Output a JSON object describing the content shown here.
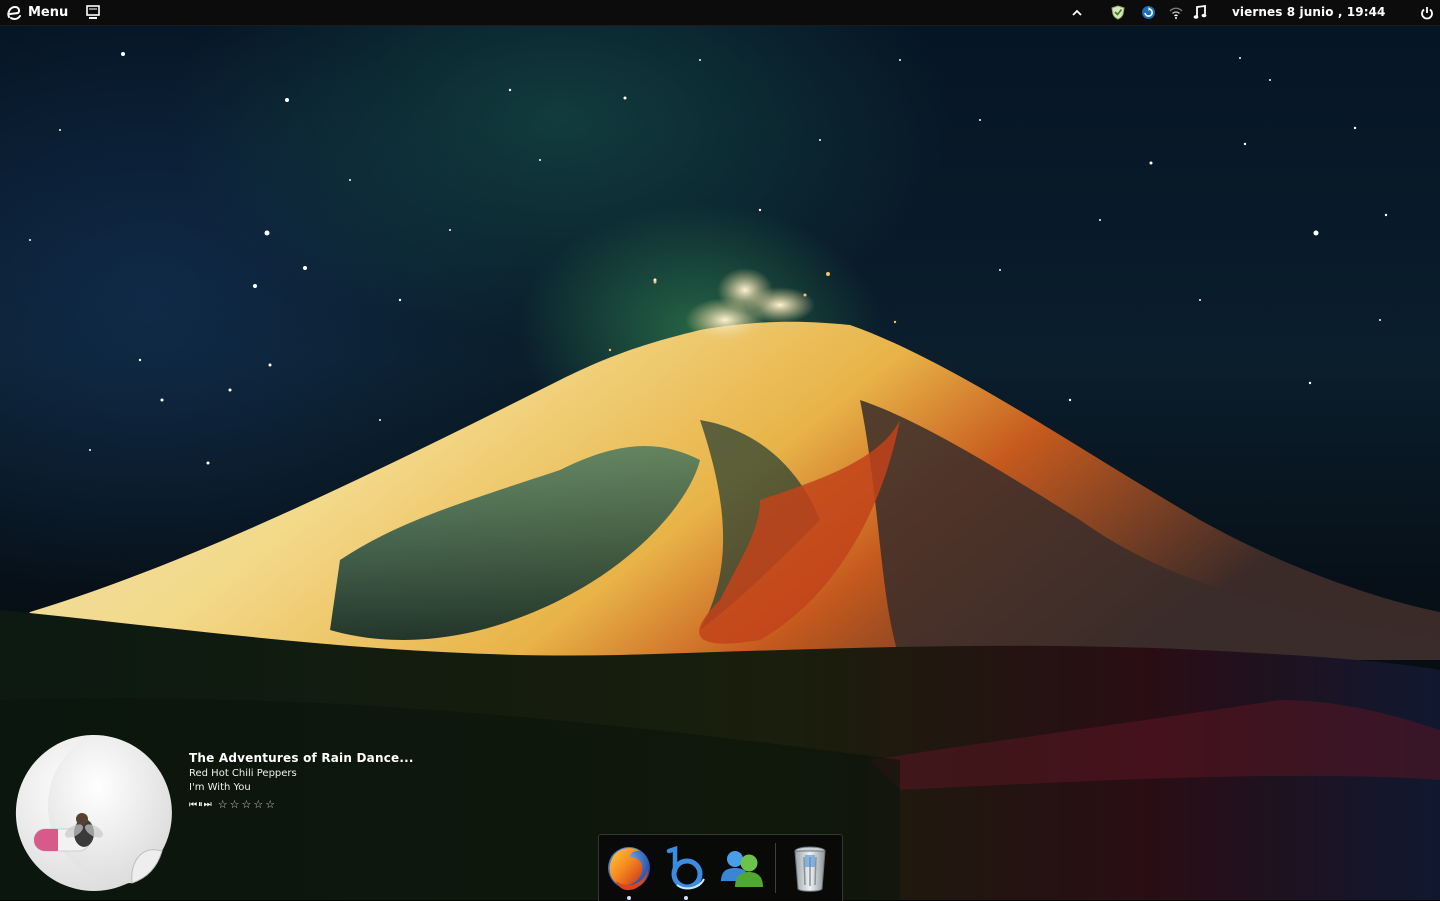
{
  "top_panel": {
    "menu_label": "Menu",
    "clock": "viernes  8 junio , 19:44"
  },
  "tray_icons": [
    "chevron-up-icon",
    "shield-icon",
    "sync-icon",
    "wifi-icon",
    "music-note-icon",
    "power-icon"
  ],
  "music_widget": {
    "title": "The Adventures of Rain Dance...",
    "artist": "Red Hot Chili Peppers",
    "album": "I'm With You",
    "rating": 0,
    "controls": {
      "previous": "⏮",
      "pause": "⏸",
      "next": "⏭"
    },
    "star_glyph": "☆"
  },
  "dock": {
    "items": [
      "firefox-icon",
      "blue-b-app-icon",
      "messenger-icon",
      "trash-icon"
    ],
    "running": [
      "firefox-icon",
      "blue-b-app-icon"
    ]
  },
  "colors": {
    "panel_bg": "#0c0c0c",
    "text": "#ffffff",
    "accent_blue": "#3a9ae0"
  }
}
